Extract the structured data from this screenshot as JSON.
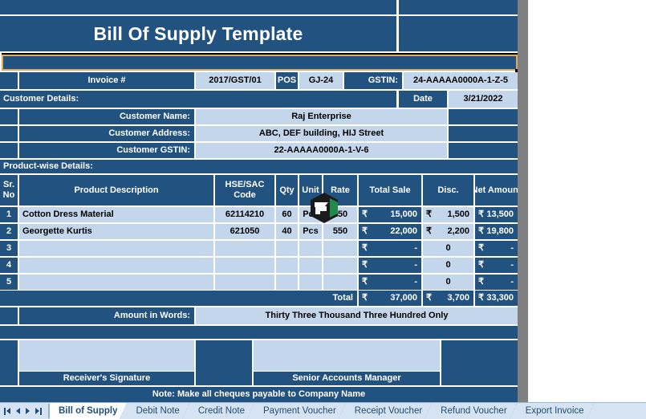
{
  "document": {
    "title": "Bill Of Supply Template"
  },
  "invoice": {
    "invoice_label": "Invoice #",
    "invoice_no": "2017/GST/01",
    "pos_label": "POS",
    "pos_value": "GJ-24",
    "gstin_label": "GSTIN:",
    "gstin_value": "24-AAAAA0000A-1-Z-5",
    "date_label": "Date",
    "date_value": "3/21/2022"
  },
  "customer": {
    "section_label": "Customer Details:",
    "name_label": "Customer Name:",
    "name_value": "Raj Enterprise",
    "address_label": "Customer Address:",
    "address_value": "ABC, DEF building, HIJ Street",
    "gstin_label": "Customer GSTIN:",
    "gstin_value": "22-AAAAA0000A-1-V-6"
  },
  "products": {
    "section_label": "Product-wise Details:",
    "headers": {
      "sr_line1": "Sr.",
      "sr_line2": "No",
      "description": "Product Description",
      "hsn_line1": "HSE/SAC",
      "hsn_line2": "Code",
      "qty": "Qty",
      "unit": "Unit",
      "rate": "Rate",
      "total_sale": "Total Sale",
      "disc": "Disc.",
      "net_amount": "Net Amount"
    },
    "currency_symbol": "₹",
    "rows": [
      {
        "sr": "1",
        "description": "Cotton Dress Material",
        "hsn": "62114210",
        "qty": "60",
        "unit": "Pcs",
        "rate": "250",
        "total_sale": "15,000",
        "disc": "1,500",
        "net_amount": "13,500"
      },
      {
        "sr": "2",
        "description": "Georgette Kurtis",
        "hsn": "621050",
        "qty": "40",
        "unit": "Pcs",
        "rate": "550",
        "total_sale": "22,000",
        "disc": "2,200",
        "net_amount": "19,800"
      },
      {
        "sr": "3",
        "description": "",
        "hsn": "",
        "qty": "",
        "unit": "",
        "rate": "",
        "total_sale": "-",
        "disc": "0",
        "net_amount": "-"
      },
      {
        "sr": "4",
        "description": "",
        "hsn": "",
        "qty": "",
        "unit": "",
        "rate": "",
        "total_sale": "-",
        "disc": "0",
        "net_amount": "-"
      },
      {
        "sr": "5",
        "description": "",
        "hsn": "",
        "qty": "",
        "unit": "",
        "rate": "",
        "total_sale": "-",
        "disc": "0",
        "net_amount": "-"
      }
    ],
    "total": {
      "label": "Total",
      "total_sale": "37,000",
      "disc": "3,700",
      "net_amount": "33,300"
    }
  },
  "footer": {
    "amount_in_words_label": "Amount in Words:",
    "amount_in_words_value": "Thirty Three Thousand Three Hundred Only",
    "receiver_signature_label": "Receiver's Signature",
    "senior_accounts_label": "Senior Accounts Manager",
    "note": "Note: Make all cheques payable to Company Name"
  },
  "sheet_tabs": {
    "items": [
      {
        "label": "Bill of Supply",
        "active": true
      },
      {
        "label": "Debit Note",
        "active": false
      },
      {
        "label": "Credit Note",
        "active": false
      },
      {
        "label": "Payment Voucher",
        "active": false
      },
      {
        "label": "Receipt Voucher",
        "active": false
      },
      {
        "label": "Refund Voucher",
        "active": false
      },
      {
        "label": "Export Invoice",
        "active": false
      }
    ]
  },
  "colors": {
    "dark_blue": "#22527F",
    "light_blue": "#C3D6EC",
    "selection_border": "#E0A861",
    "gutter_gray": "#808080"
  }
}
